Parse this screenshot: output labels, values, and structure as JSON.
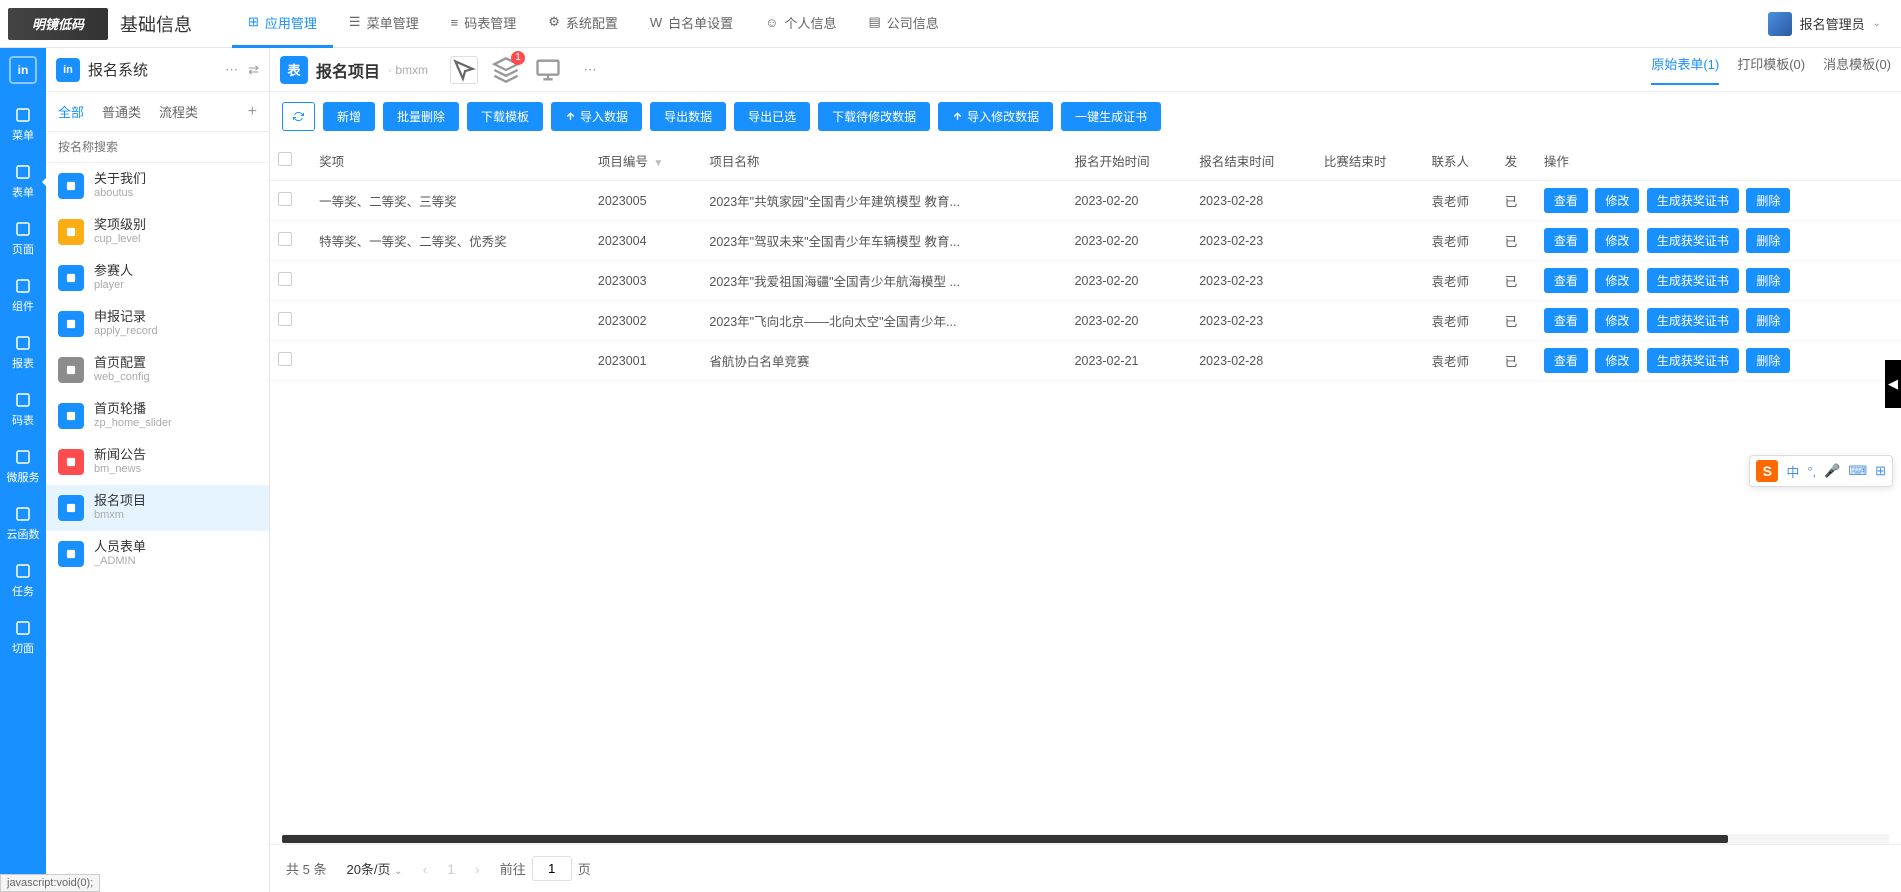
{
  "logo_text": "明镜低码",
  "header_title": "基础信息",
  "top_nav": [
    {
      "label": "应用管理",
      "active": true
    },
    {
      "label": "菜单管理",
      "active": false
    },
    {
      "label": "码表管理",
      "active": false
    },
    {
      "label": "系统配置",
      "active": false
    },
    {
      "label": "白名单设置",
      "active": false
    },
    {
      "label": "个人信息",
      "active": false
    },
    {
      "label": "公司信息",
      "active": false
    }
  ],
  "user_name": "报名管理员",
  "rail": {
    "badge": "in",
    "items": [
      {
        "label": "菜单"
      },
      {
        "label": "表单",
        "active": true
      },
      {
        "label": "页面"
      },
      {
        "label": "组件"
      },
      {
        "label": "报表"
      },
      {
        "label": "码表"
      },
      {
        "label": "微服务"
      },
      {
        "label": "云函数"
      },
      {
        "label": "任务"
      },
      {
        "label": "切面"
      }
    ]
  },
  "left_panel": {
    "app_name": "报名系统",
    "tabs": [
      {
        "label": "全部",
        "active": true
      },
      {
        "label": "普通类",
        "active": false
      },
      {
        "label": "流程类",
        "active": false
      }
    ],
    "search_placeholder": "按名称搜索",
    "tree": [
      {
        "label": "关于我们",
        "sub": "aboutus",
        "color": "#1890ff"
      },
      {
        "label": "奖项级别",
        "sub": "cup_level",
        "color": "#faad14"
      },
      {
        "label": "参赛人",
        "sub": "player",
        "color": "#1890ff"
      },
      {
        "label": "申报记录",
        "sub": "apply_record",
        "color": "#1890ff"
      },
      {
        "label": "首页配置",
        "sub": "web_config",
        "color": "#8c8c8c"
      },
      {
        "label": "首页轮播",
        "sub": "zp_home_slider",
        "color": "#1890ff"
      },
      {
        "label": "新闻公告",
        "sub": "bm_news",
        "color": "#ff4d4f"
      },
      {
        "label": "报名项目",
        "sub": "bmxm",
        "color": "#1890ff",
        "active": true
      },
      {
        "label": "人员表单",
        "sub": "_ADMIN",
        "color": "#1890ff"
      }
    ]
  },
  "content": {
    "table_badge": "表",
    "title": "报名项目",
    "code": "· bmxm",
    "layer_badge": "1",
    "header_tabs": [
      {
        "label": "原始表单(1)",
        "active": true
      },
      {
        "label": "打印模板(0)",
        "active": false
      },
      {
        "label": "消息模板(0)",
        "active": false
      }
    ],
    "toolbar": {
      "refresh": "↻",
      "add": "新增",
      "batch_delete": "批量删除",
      "download_tpl": "下载模板",
      "import_data": "导入数据",
      "export_data": "导出数据",
      "export_selected": "导出已选",
      "download_modify": "下载待修改数据",
      "import_modify": "导入修改数据",
      "gen_cert": "一键生成证书"
    },
    "columns": [
      "奖项",
      "项目编号",
      "项目名称",
      "报名开始时间",
      "报名结束时间",
      "比赛结束时",
      "联系人",
      "发",
      "操作"
    ],
    "rows": [
      {
        "award": "一等奖、二等奖、三等奖",
        "code": "2023005",
        "name": "2023年\"共筑家园\"全国青少年建筑模型 教育...",
        "start": "2023-02-20",
        "end": "2023-02-28",
        "match_end": "",
        "contact": "袁老师",
        "pub": "已"
      },
      {
        "award": "特等奖、一等奖、二等奖、优秀奖",
        "code": "2023004",
        "name": "2023年\"驾驭未来\"全国青少年车辆模型 教育...",
        "start": "2023-02-20",
        "end": "2023-02-23",
        "match_end": "",
        "contact": "袁老师",
        "pub": "已"
      },
      {
        "award": "",
        "code": "2023003",
        "name": "2023年\"我爱祖国海疆\"全国青少年航海模型 ...",
        "start": "2023-02-20",
        "end": "2023-02-23",
        "match_end": "",
        "contact": "袁老师",
        "pub": "已"
      },
      {
        "award": "",
        "code": "2023002",
        "name": "2023年\"飞向北京——北向太空\"全国青少年...",
        "start": "2023-02-20",
        "end": "2023-02-23",
        "match_end": "",
        "contact": "袁老师",
        "pub": "已"
      },
      {
        "award": "",
        "code": "2023001",
        "name": "省航协白名单竞赛",
        "start": "2023-02-21",
        "end": "2023-02-28",
        "match_end": "",
        "contact": "袁老师",
        "pub": "已"
      }
    ],
    "row_actions": {
      "view": "查看",
      "edit": "修改",
      "gen": "生成获奖证书",
      "del": "删除"
    }
  },
  "pager": {
    "total_label": "共 5 条",
    "page_size": "20条/页",
    "current": "1",
    "jump_prefix": "前往",
    "jump_value": "1",
    "jump_suffix": "页"
  },
  "status_bar": "javascript:void(0);",
  "ime": {
    "logo": "S",
    "lang": "中"
  }
}
